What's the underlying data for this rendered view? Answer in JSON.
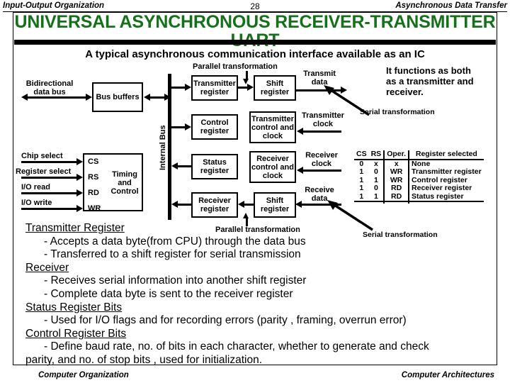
{
  "header": {
    "left": "Input-Output Organization",
    "page_number": "28",
    "right": "Asynchronous Data Transfer"
  },
  "slide": {
    "title_line1": "UNIVERSAL ASYNCHRONOUS RECEIVER-TRANSMITTER",
    "title_line2": "- UART -",
    "title_color": "#15701a",
    "subtitle": "A typical asynchronous communication interface available as an IC"
  },
  "diagram": {
    "labels": {
      "bidirectional_data_bus": "Bidirectional\ndata bus",
      "chip_select": "Chip select",
      "register_select": "Register select",
      "io_read": "I/O read",
      "io_write": "I/O write",
      "internal_bus": "Internal Bus",
      "parallel_transformation_top": "Parallel transformation",
      "parallel_transformation_bottom": "Parallel transformation",
      "transmit_data": "Transmit\ndata",
      "transmitter_clock": "Transmitter\nclock",
      "receiver_clock": "Receiver\nclock",
      "receive_data": "Receive\ndata",
      "serial_transformation_top": "Serial transformation",
      "serial_transformation_bottom": "Serial transformation"
    },
    "boxes": {
      "bus_buffers": "Bus\nbuffers",
      "timing_and_control": "Timing\nand\nControl",
      "cs": "CS",
      "rs": "RS",
      "rd": "RD",
      "wr": "WR",
      "transmitter_register": "Transmitter\nregister",
      "shift_register_tx": "Shift\nregister",
      "control_register": "Control\nregister",
      "transmitter_control_and_clock": "Transmitter\ncontrol\nand clock",
      "status_register": "Status\nregister",
      "receiver_control_and_clock": "Receiver\ncontrol\nand clock",
      "receiver_register": "Receiver\nregister",
      "shift_register_rx": "Shift\nregister"
    }
  },
  "callout": {
    "line1": "It functions as both",
    "line2": "as a transmitter and",
    "line3": "receiver."
  },
  "table": {
    "headers": [
      "CS",
      "RS",
      "Oper.",
      "Register selected"
    ],
    "rows": [
      [
        "0",
        "x",
        "x",
        "None"
      ],
      [
        "1",
        "0",
        "WR",
        "Transmitter register"
      ],
      [
        "1",
        "1",
        "WR",
        "Control register"
      ],
      [
        "1",
        "0",
        "RD",
        "Receiver register"
      ],
      [
        "1",
        "1",
        "RD",
        "Status register"
      ]
    ]
  },
  "body": {
    "h1": "Transmitter Register",
    "b1": "- Accepts a data byte(from CPU) through the data bus",
    "b2": "- Transferred to a shift register for serial transmission",
    "h2": "Receiver",
    "b3": "- Receives serial information into another shift register",
    "b4": "- Complete data byte is sent to the receiver register",
    "h3": "Status Register Bits",
    "b5": "- Used for I/O flags and for recording errors (parity , framing, overrun error)",
    "h4": "Control Register Bits",
    "b6": "- Define baud rate, no. of bits in each character, whether  to generate and check",
    "b7": "parity, and no. of stop bits , used for initialization."
  },
  "footer": {
    "left": "Computer Organization",
    "right": "Computer Architectures"
  }
}
